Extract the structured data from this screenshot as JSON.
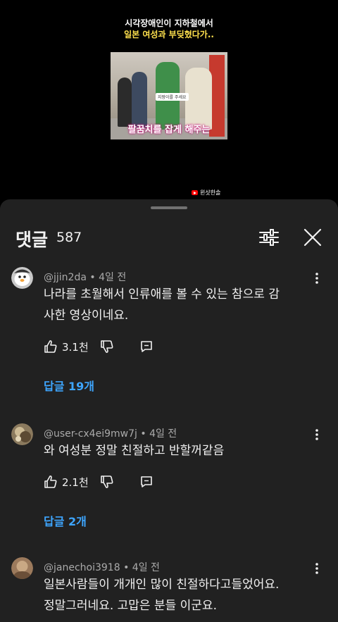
{
  "video": {
    "title_line1": "시각장애인이 지하철에서",
    "title_line2": "일본 여성과 부딪혔다가..",
    "thumbnail_caption": "팔꿈치를 잡게 해주는",
    "thumbnail_sign": "지팡이를 주세요",
    "channel_name": "윈샷한솔"
  },
  "sheet": {
    "title": "댓글",
    "count": "587"
  },
  "comments": [
    {
      "author": "@jjin2da",
      "separator": "•",
      "time": "4일 전",
      "lines": [
        "나라를 초월해서 인류애를 볼 수 있는 참으로 감",
        "사한 영상이네요."
      ],
      "likes": "3.1천",
      "replies_label": "답글 19개"
    },
    {
      "author": "@user-cx4ei9mw7j",
      "separator": "•",
      "time": "4일 전",
      "lines": [
        "와 여성분 정말 친절하고 반할꺼같음"
      ],
      "likes": "2.1천",
      "replies_label": "답글 2개"
    },
    {
      "author": "@janechoi3918",
      "separator": "•",
      "time": "4일 전",
      "lines": [
        "일본사람들이 개개인 많이 친절하다고들었어요.",
        "정말그러네요. 고맙은 분들 이군요."
      ]
    }
  ],
  "colors": {
    "sheet_bg": "#212121",
    "link_blue": "#3ea6ff",
    "meta_gray": "#aaaaaa"
  }
}
